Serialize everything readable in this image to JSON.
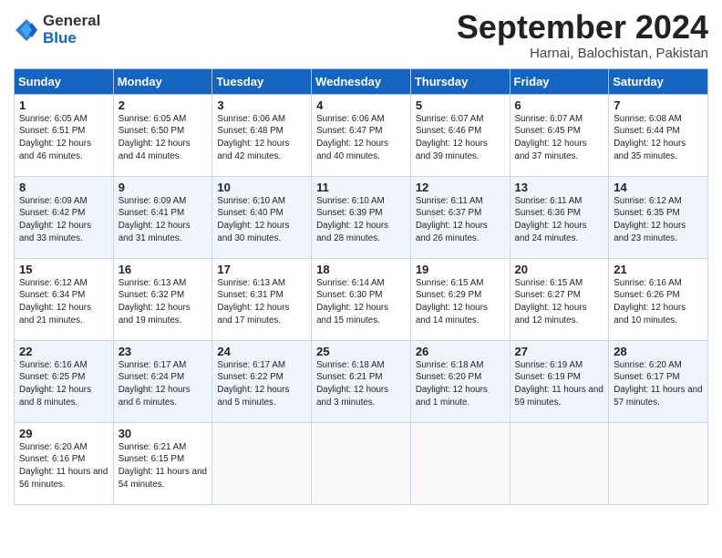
{
  "logo": {
    "general": "General",
    "blue": "Blue"
  },
  "header": {
    "month": "September 2024",
    "location": "Harnai, Balochistan, Pakistan"
  },
  "weekdays": [
    "Sunday",
    "Monday",
    "Tuesday",
    "Wednesday",
    "Thursday",
    "Friday",
    "Saturday"
  ],
  "weeks": [
    [
      {
        "day": 1,
        "sunrise": "6:05 AM",
        "sunset": "6:51 PM",
        "daylight": "12 hours and 46 minutes."
      },
      {
        "day": 2,
        "sunrise": "6:05 AM",
        "sunset": "6:50 PM",
        "daylight": "12 hours and 44 minutes."
      },
      {
        "day": 3,
        "sunrise": "6:06 AM",
        "sunset": "6:48 PM",
        "daylight": "12 hours and 42 minutes."
      },
      {
        "day": 4,
        "sunrise": "6:06 AM",
        "sunset": "6:47 PM",
        "daylight": "12 hours and 40 minutes."
      },
      {
        "day": 5,
        "sunrise": "6:07 AM",
        "sunset": "6:46 PM",
        "daylight": "12 hours and 39 minutes."
      },
      {
        "day": 6,
        "sunrise": "6:07 AM",
        "sunset": "6:45 PM",
        "daylight": "12 hours and 37 minutes."
      },
      {
        "day": 7,
        "sunrise": "6:08 AM",
        "sunset": "6:44 PM",
        "daylight": "12 hours and 35 minutes."
      }
    ],
    [
      {
        "day": 8,
        "sunrise": "6:09 AM",
        "sunset": "6:42 PM",
        "daylight": "12 hours and 33 minutes."
      },
      {
        "day": 9,
        "sunrise": "6:09 AM",
        "sunset": "6:41 PM",
        "daylight": "12 hours and 31 minutes."
      },
      {
        "day": 10,
        "sunrise": "6:10 AM",
        "sunset": "6:40 PM",
        "daylight": "12 hours and 30 minutes."
      },
      {
        "day": 11,
        "sunrise": "6:10 AM",
        "sunset": "6:39 PM",
        "daylight": "12 hours and 28 minutes."
      },
      {
        "day": 12,
        "sunrise": "6:11 AM",
        "sunset": "6:37 PM",
        "daylight": "12 hours and 26 minutes."
      },
      {
        "day": 13,
        "sunrise": "6:11 AM",
        "sunset": "6:36 PM",
        "daylight": "12 hours and 24 minutes."
      },
      {
        "day": 14,
        "sunrise": "6:12 AM",
        "sunset": "6:35 PM",
        "daylight": "12 hours and 23 minutes."
      }
    ],
    [
      {
        "day": 15,
        "sunrise": "6:12 AM",
        "sunset": "6:34 PM",
        "daylight": "12 hours and 21 minutes."
      },
      {
        "day": 16,
        "sunrise": "6:13 AM",
        "sunset": "6:32 PM",
        "daylight": "12 hours and 19 minutes."
      },
      {
        "day": 17,
        "sunrise": "6:13 AM",
        "sunset": "6:31 PM",
        "daylight": "12 hours and 17 minutes."
      },
      {
        "day": 18,
        "sunrise": "6:14 AM",
        "sunset": "6:30 PM",
        "daylight": "12 hours and 15 minutes."
      },
      {
        "day": 19,
        "sunrise": "6:15 AM",
        "sunset": "6:29 PM",
        "daylight": "12 hours and 14 minutes."
      },
      {
        "day": 20,
        "sunrise": "6:15 AM",
        "sunset": "6:27 PM",
        "daylight": "12 hours and 12 minutes."
      },
      {
        "day": 21,
        "sunrise": "6:16 AM",
        "sunset": "6:26 PM",
        "daylight": "12 hours and 10 minutes."
      }
    ],
    [
      {
        "day": 22,
        "sunrise": "6:16 AM",
        "sunset": "6:25 PM",
        "daylight": "12 hours and 8 minutes."
      },
      {
        "day": 23,
        "sunrise": "6:17 AM",
        "sunset": "6:24 PM",
        "daylight": "12 hours and 6 minutes."
      },
      {
        "day": 24,
        "sunrise": "6:17 AM",
        "sunset": "6:22 PM",
        "daylight": "12 hours and 5 minutes."
      },
      {
        "day": 25,
        "sunrise": "6:18 AM",
        "sunset": "6:21 PM",
        "daylight": "12 hours and 3 minutes."
      },
      {
        "day": 26,
        "sunrise": "6:18 AM",
        "sunset": "6:20 PM",
        "daylight": "12 hours and 1 minute."
      },
      {
        "day": 27,
        "sunrise": "6:19 AM",
        "sunset": "6:19 PM",
        "daylight": "11 hours and 59 minutes."
      },
      {
        "day": 28,
        "sunrise": "6:20 AM",
        "sunset": "6:17 PM",
        "daylight": "11 hours and 57 minutes."
      }
    ],
    [
      {
        "day": 29,
        "sunrise": "6:20 AM",
        "sunset": "6:16 PM",
        "daylight": "11 hours and 56 minutes."
      },
      {
        "day": 30,
        "sunrise": "6:21 AM",
        "sunset": "6:15 PM",
        "daylight": "11 hours and 54 minutes."
      },
      null,
      null,
      null,
      null,
      null
    ]
  ]
}
